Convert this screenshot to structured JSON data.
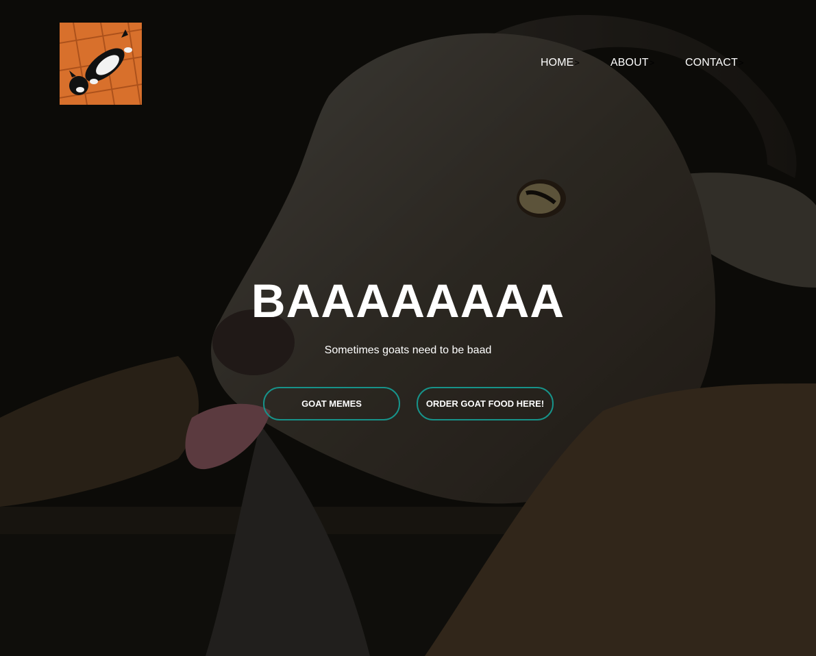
{
  "colors": {
    "accent": "#17938a",
    "text": "#ffffff",
    "overlay": "#15140f"
  },
  "logo": {
    "icon": "cat-logo-image"
  },
  "nav": {
    "items": [
      {
        "label": "HOME",
        "arrow": ">"
      },
      {
        "label": "ABOUT",
        "arrow": ">"
      },
      {
        "label": "CONTACT",
        "arrow": ">"
      }
    ]
  },
  "hero": {
    "title": "BAAAAAAAA",
    "subtitle": "Sometimes goats need to be baad",
    "background": "goat-photo",
    "buttons": [
      {
        "label": "GOAT MEMES"
      },
      {
        "label": "ORDER GOAT FOOD HERE!"
      }
    ]
  }
}
